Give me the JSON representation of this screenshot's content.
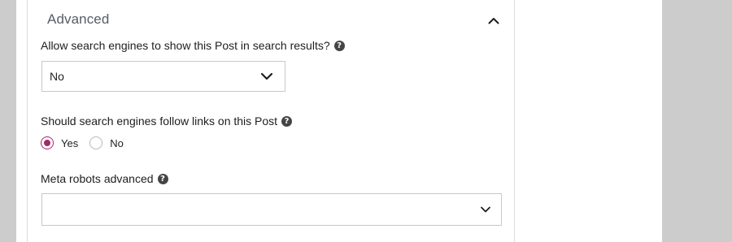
{
  "section": {
    "title": "Advanced",
    "toggle_icon": "chevron-up-icon"
  },
  "search_results_field": {
    "label": "Allow search engines to show this Post in search results?",
    "help_icon": "?",
    "selected_value": "No",
    "chevron_icon": "chevron-down-icon"
  },
  "follow_links_field": {
    "label": "Should search engines follow links on this Post",
    "help_icon": "?",
    "options": [
      {
        "label": "Yes",
        "checked": true
      },
      {
        "label": "No",
        "checked": false
      }
    ]
  },
  "meta_robots_field": {
    "label": "Meta robots advanced",
    "help_icon": "?",
    "selected_value": "",
    "chevron_icon": "chevron-down-icon"
  },
  "colors": {
    "accent": "#a4286a",
    "page_background": "#cccccc",
    "panel_background": "#ffffff",
    "border": "#c8c8c8"
  }
}
